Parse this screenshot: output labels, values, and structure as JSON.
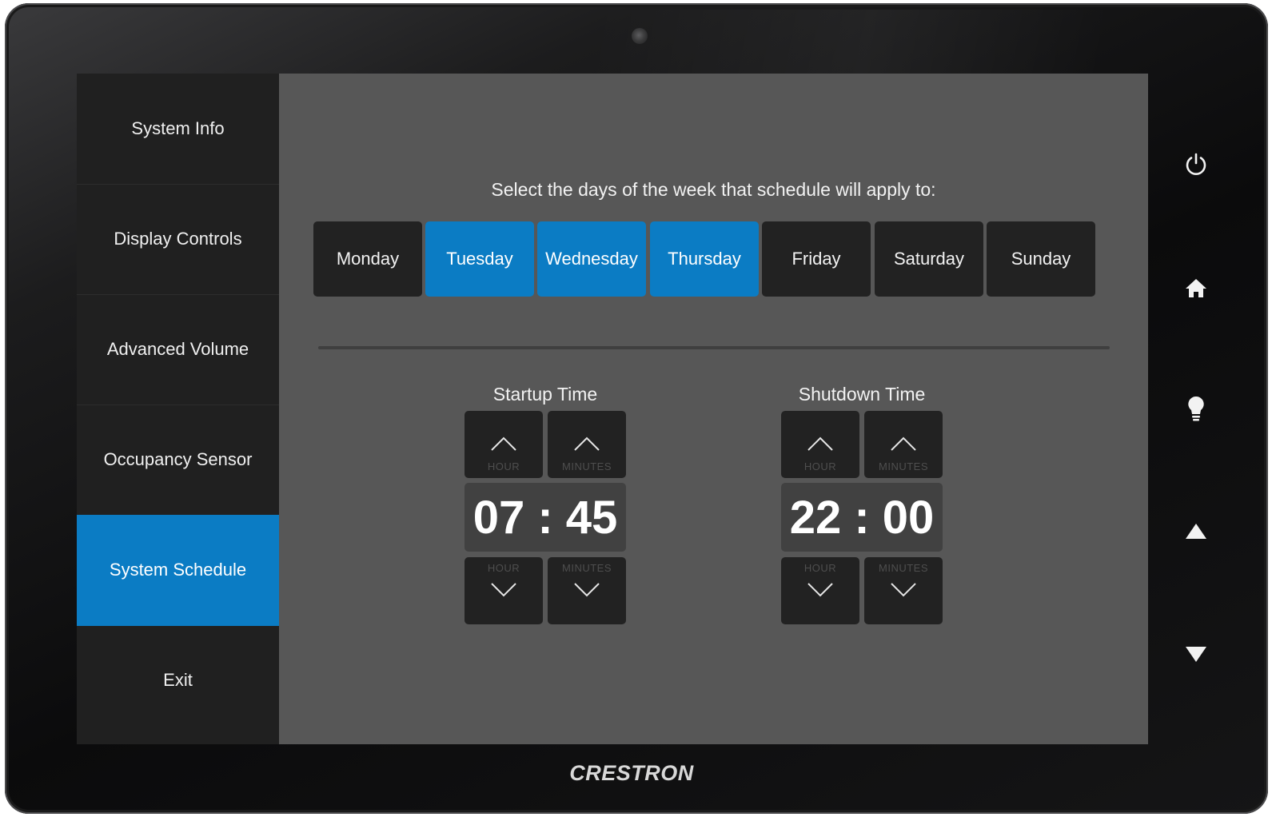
{
  "sidebar": {
    "items": [
      {
        "label": "System Info",
        "active": false
      },
      {
        "label": "Display Controls",
        "active": false
      },
      {
        "label": "Advanced Volume",
        "active": false
      },
      {
        "label": "Occupancy Sensor",
        "active": false
      },
      {
        "label": "System Schedule",
        "active": true
      },
      {
        "label": "Exit",
        "active": false
      }
    ]
  },
  "schedule": {
    "prompt": "Select the days of the week that schedule will apply to:",
    "days": [
      {
        "label": "Monday",
        "selected": false
      },
      {
        "label": "Tuesday",
        "selected": true
      },
      {
        "label": "Wednesday",
        "selected": true
      },
      {
        "label": "Thursday",
        "selected": true
      },
      {
        "label": "Friday",
        "selected": false
      },
      {
        "label": "Saturday",
        "selected": false
      },
      {
        "label": "Sunday",
        "selected": false
      }
    ],
    "startup": {
      "title": "Startup Time",
      "hour_label": "HOUR",
      "minutes_label": "MINUTES",
      "time": "07 : 45"
    },
    "shutdown": {
      "title": "Shutdown Time",
      "hour_label": "HOUR",
      "minutes_label": "MINUTES",
      "time": "22 : 00"
    }
  },
  "hardware_buttons": [
    "power-icon",
    "home-icon",
    "lightbulb-icon",
    "triangle-up-icon",
    "triangle-down-icon"
  ],
  "brand": "CRESTRON",
  "colors": {
    "accent": "#0b7cc4",
    "button_bg": "#222222",
    "screen_bg": "#575757",
    "sidebar_bg": "#202020"
  }
}
